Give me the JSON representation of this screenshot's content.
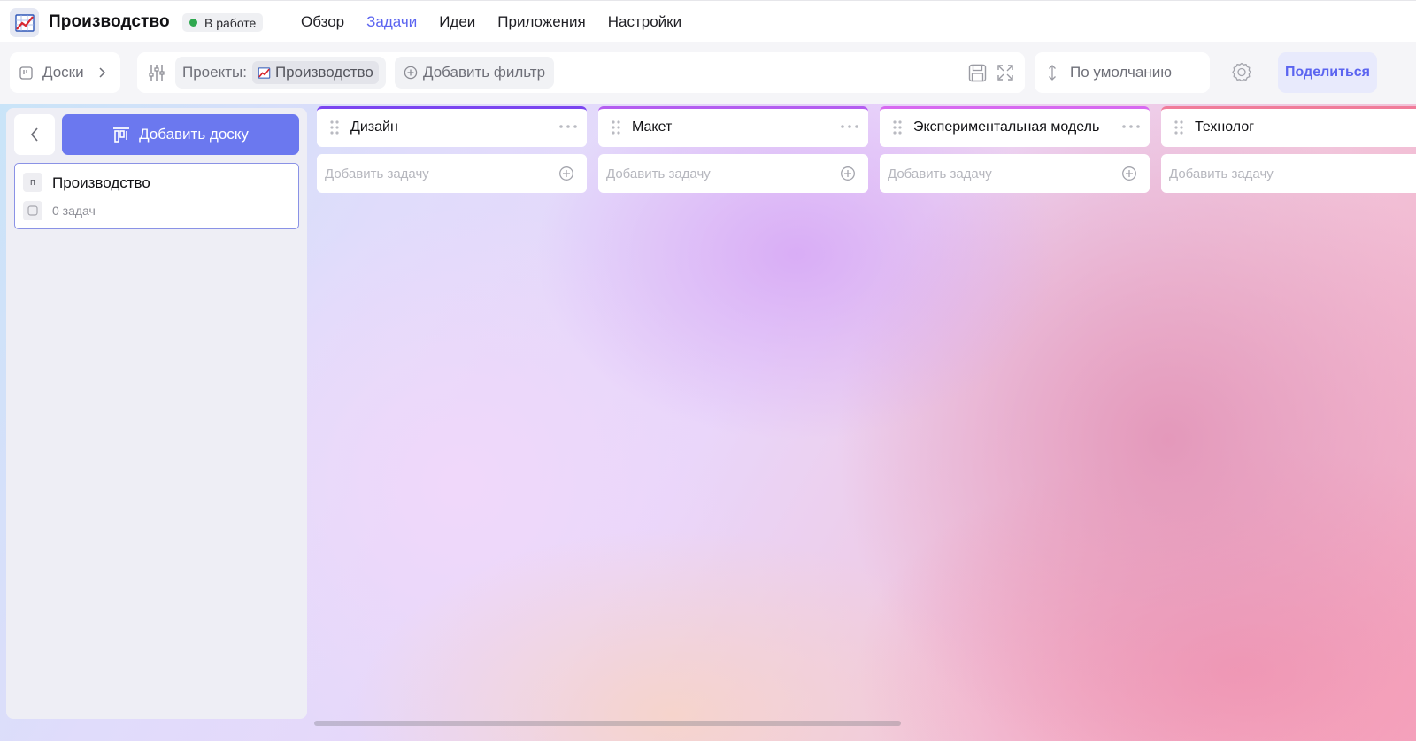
{
  "header": {
    "app_title": "Производство",
    "status": {
      "label": "В работе",
      "color": "#2fa84f"
    },
    "nav": [
      {
        "label": "Обзор",
        "active": false
      },
      {
        "label": "Задачи",
        "active": true
      },
      {
        "label": "Идеи",
        "active": false
      },
      {
        "label": "Приложения",
        "active": false
      },
      {
        "label": "Настройки",
        "active": false
      }
    ],
    "accent_color": "#5b64f0"
  },
  "toolbar": {
    "boards_label": "Доски",
    "projects_label": "Проекты:",
    "project_name": "Производство",
    "add_filter_label": "Добавить фильтр",
    "sort_label": "По умолчанию",
    "share_label": "Поделиться"
  },
  "sidebar": {
    "add_board_label": "Добавить доску",
    "boards": [
      {
        "initial": "п",
        "name": "Производство",
        "tasks": "0 задач"
      }
    ]
  },
  "columns": [
    {
      "title": "Дизайн",
      "accent": "#7b45f0",
      "placeholder": "Добавить задачу"
    },
    {
      "title": "Макет",
      "accent": "#b45df0",
      "placeholder": "Добавить задачу"
    },
    {
      "title": "Экспериментальная модель",
      "accent": "#d769f0",
      "placeholder": "Добавить задачу"
    },
    {
      "title": "Технолог",
      "accent": "#f07c9a",
      "placeholder": "Добавить задачу"
    }
  ]
}
